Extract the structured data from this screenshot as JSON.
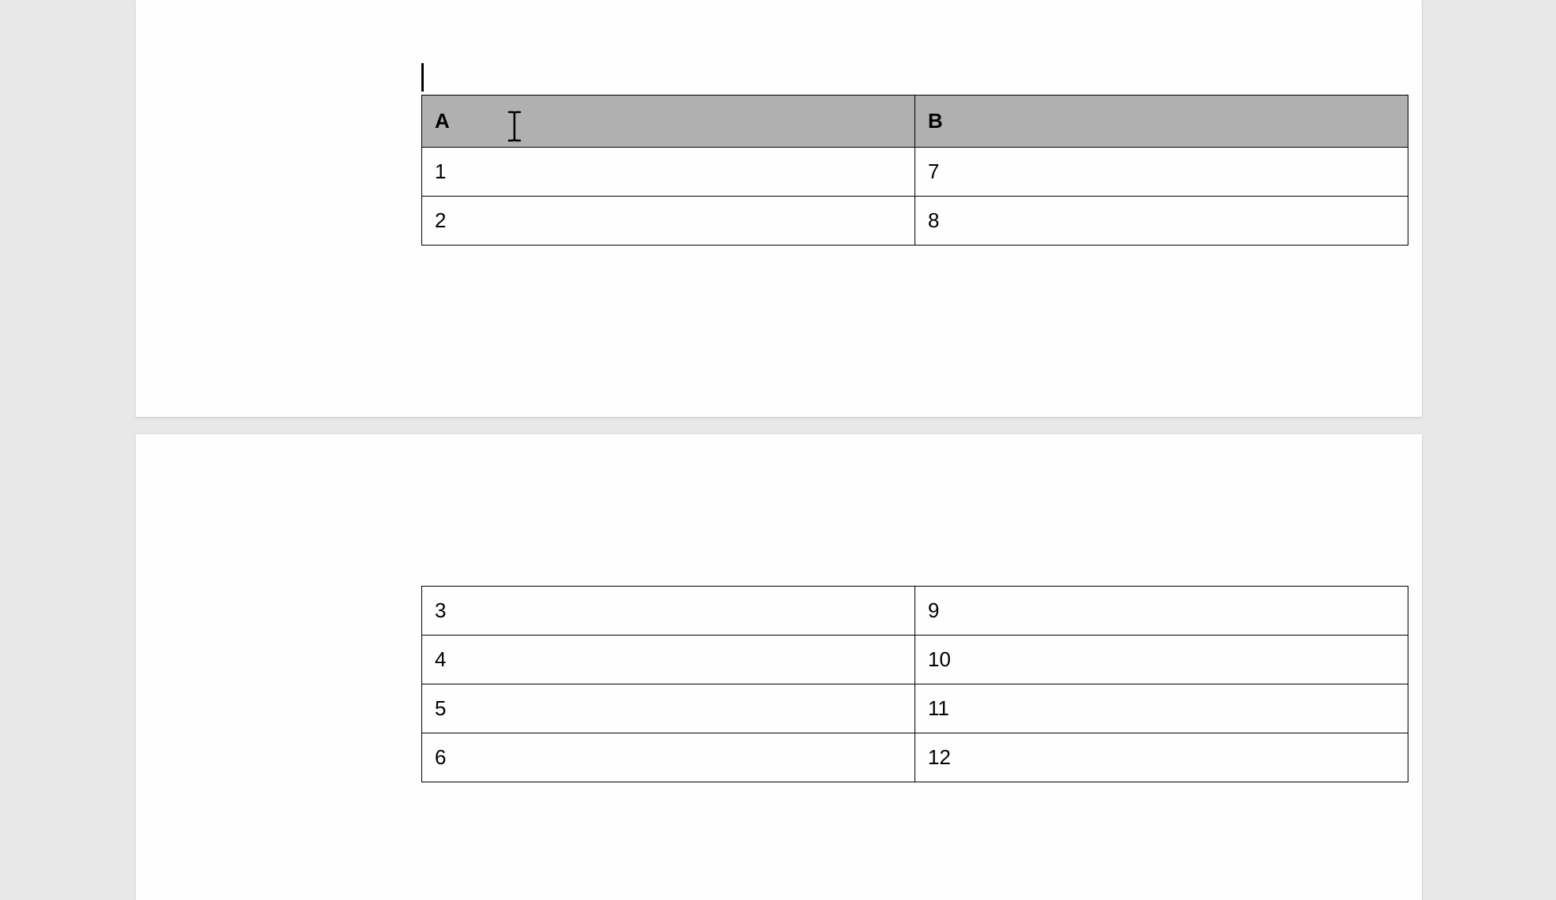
{
  "cursor": {
    "type": "text-ibeam",
    "page": 1
  },
  "page1": {
    "table": {
      "headers": [
        "A",
        "B"
      ],
      "rows": [
        {
          "a": "1",
          "b": "7"
        },
        {
          "a": "2",
          "b": "8"
        }
      ]
    }
  },
  "page2": {
    "table": {
      "rows": [
        {
          "a": "3",
          "b": "9"
        },
        {
          "a": "4",
          "b": "10"
        },
        {
          "a": "5",
          "b": "11"
        },
        {
          "a": "6",
          "b": "12"
        }
      ]
    }
  }
}
